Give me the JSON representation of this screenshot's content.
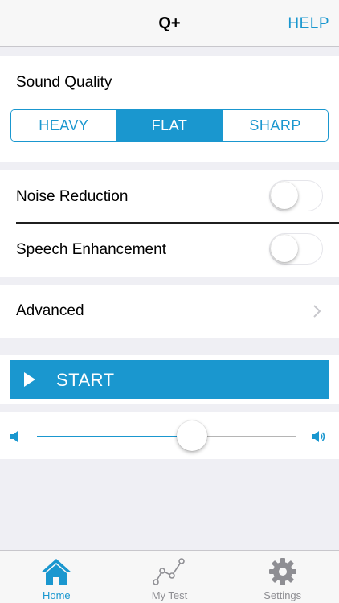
{
  "nav": {
    "title": "Q+",
    "help_label": "HELP"
  },
  "sound_quality": {
    "label": "Sound Quality",
    "options": [
      "HEAVY",
      "FLAT",
      "SHARP"
    ],
    "selected": "FLAT"
  },
  "toggles": {
    "noise_reduction": {
      "label": "Noise Reduction",
      "on": false
    },
    "speech_enhancement": {
      "label": "Speech Enhancement",
      "on": false
    }
  },
  "advanced": {
    "label": "Advanced"
  },
  "start": {
    "label": "START"
  },
  "volume": {
    "level": 0.6
  },
  "tabs": [
    {
      "label": "Home",
      "icon": "home-icon",
      "active": true
    },
    {
      "label": "My Test",
      "icon": "chart-line-icon",
      "active": false
    },
    {
      "label": "Settings",
      "icon": "gear-icon",
      "active": false
    }
  ],
  "colors": {
    "accent": "#1a97cf",
    "background": "#efeff4",
    "inactive": "#8e8e93"
  }
}
